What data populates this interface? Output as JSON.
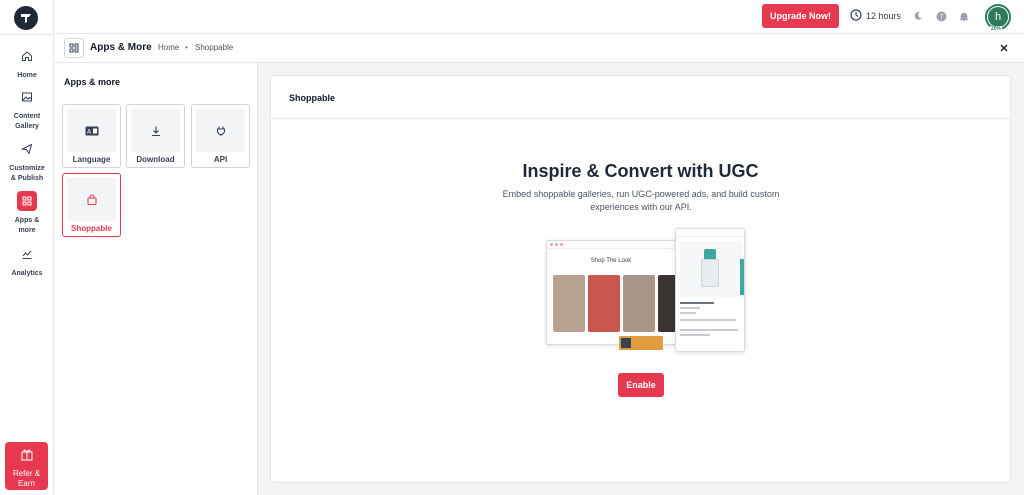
{
  "app": {
    "logo_icon": "brand-logo-icon"
  },
  "sidebar": {
    "items": [
      {
        "label": "Home",
        "icon": "home-icon"
      },
      {
        "label": "Content Gallery",
        "icon": "image-icon"
      },
      {
        "label": "Customize & Publish",
        "icon": "send-icon"
      },
      {
        "label": "Apps & more",
        "icon": "apps-grid-icon",
        "active": true
      },
      {
        "label": "Analytics",
        "icon": "chart-icon"
      }
    ],
    "refer": {
      "label": "Refer & Earn",
      "icon": "gift-icon"
    }
  },
  "topbar": {
    "upgrade_label": "Upgrade Now!",
    "hours_label": "12 hours",
    "avatar_initial": "h",
    "avatar_progress": "20%"
  },
  "breadcrumb": {
    "title": "Apps & More",
    "items": [
      "Home",
      "Shoppable"
    ]
  },
  "left_panel": {
    "title": "Apps & more",
    "cards": [
      {
        "label": "Language",
        "icon": "language-icon"
      },
      {
        "label": "Download",
        "icon": "download-icon"
      },
      {
        "label": "API",
        "icon": "plug-icon"
      },
      {
        "label": "Shoppable",
        "icon": "shopping-bag-icon",
        "active": true
      }
    ]
  },
  "main": {
    "header_title": "Shoppable",
    "hero_title": "Inspire & Convert with UGC",
    "hero_description": "Embed shoppable galleries, run UGC-powered ads, and build custom experiences with our API.",
    "illustration_title": "Shop The Look",
    "enable_label": "Enable"
  },
  "colors": {
    "accent": "#e63950",
    "avatar": "#2f7a5a"
  }
}
